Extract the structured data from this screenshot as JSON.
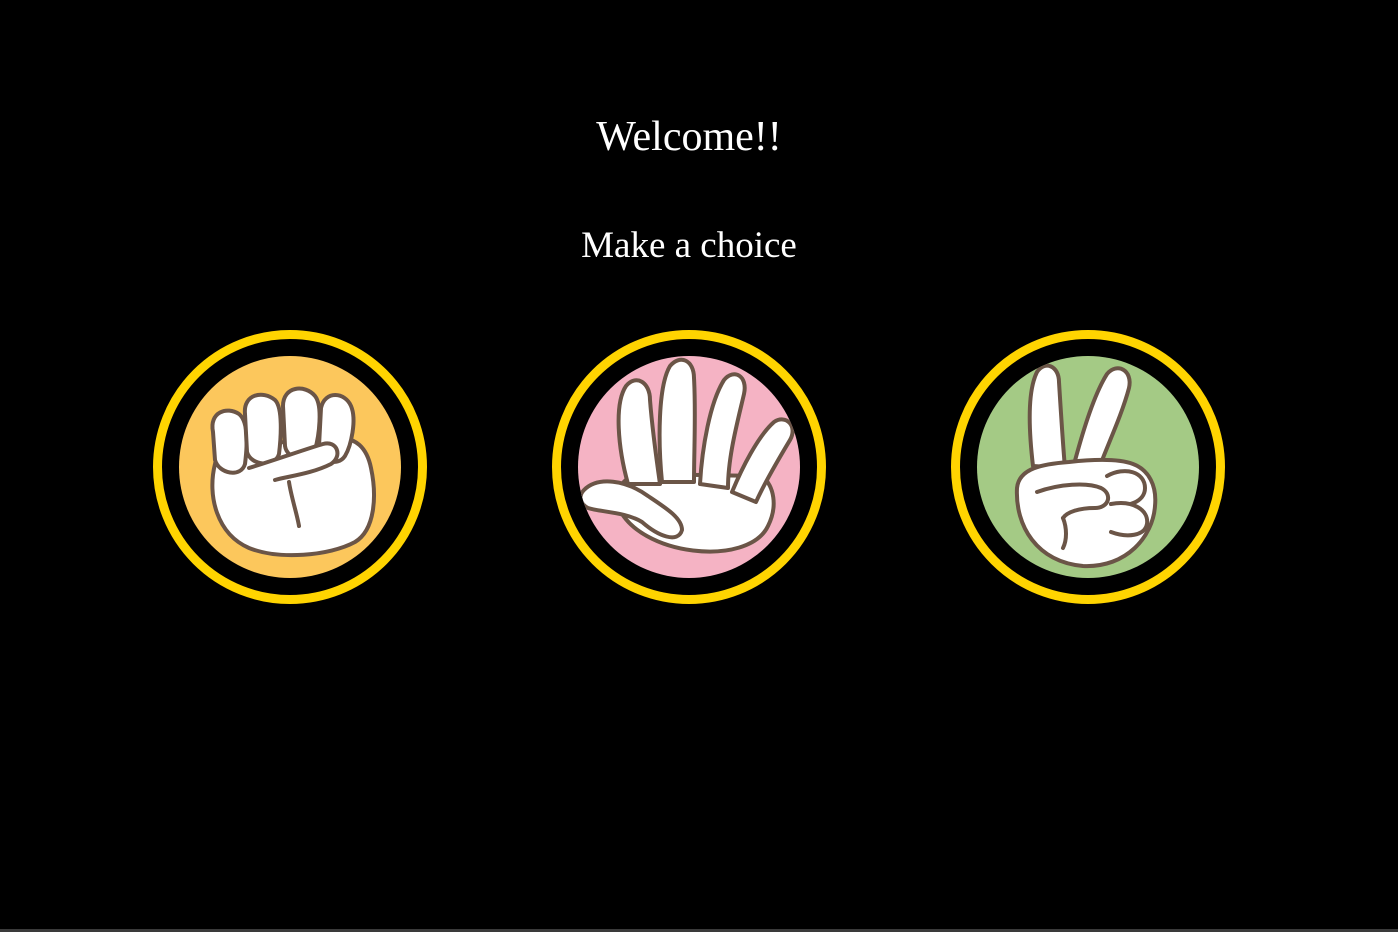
{
  "header": {
    "title": "Welcome!!",
    "prompt": "Make a choice"
  },
  "choices": [
    {
      "id": "rock",
      "icon": "rock-fist-icon",
      "disc_color": "#fcc75c"
    },
    {
      "id": "paper",
      "icon": "paper-hand-icon",
      "disc_color": "#f5b3c4"
    },
    {
      "id": "scissors",
      "icon": "scissors-hand-icon",
      "disc_color": "#a4ca85"
    }
  ],
  "colors": {
    "background": "#000000",
    "ring": "#ffd400",
    "text": "#ffffff",
    "hand_fill": "#ffffff",
    "hand_outline": "#6b5547"
  }
}
